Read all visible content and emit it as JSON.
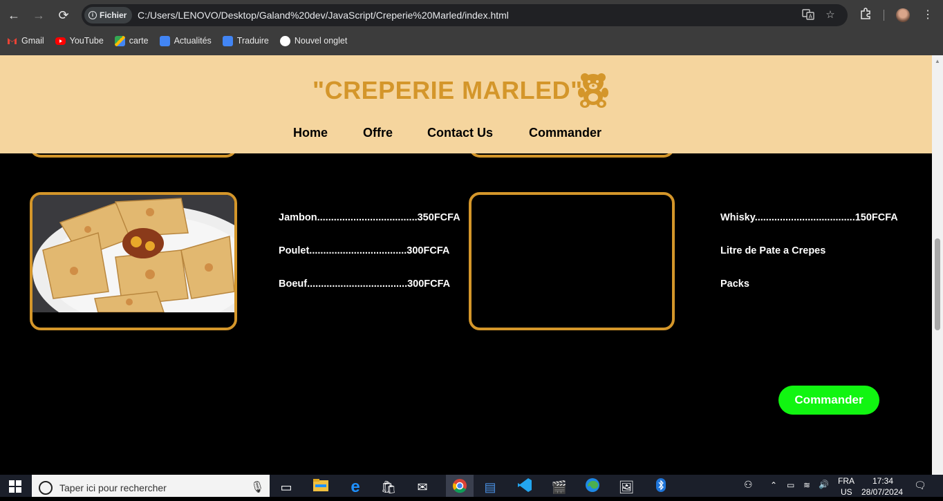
{
  "browser": {
    "back": "←",
    "forward": "→",
    "reload": "⟳",
    "chip_label": "Fichier",
    "url": "C:/Users/LENOVO/Desktop/Galand%20dev/JavaScript/Creperie%20Marled/index.html",
    "bookmarks": [
      {
        "label": "Gmail",
        "icon": "gmail-icon",
        "color": "#ea4335"
      },
      {
        "label": "YouTube",
        "icon": "youtube-icon",
        "color": "#ff0000"
      },
      {
        "label": "carte",
        "icon": "maps-icon",
        "color": "#34a853"
      },
      {
        "label": "Actualités",
        "icon": "news-icon",
        "color": "#4285f4"
      },
      {
        "label": "Traduire",
        "icon": "translate-icon",
        "color": "#4285f4"
      },
      {
        "label": "Nouvel onglet",
        "icon": "globe-icon",
        "color": "#ffffff"
      }
    ]
  },
  "site": {
    "brand": "\"CREPERIE MARLED\"",
    "accent": "#d4962a",
    "header_bg": "#f5d59e",
    "menu": [
      "Home",
      "Offre",
      "Contact Us",
      "Commander"
    ]
  },
  "menu_left": {
    "items": [
      "Jambon....................................350FCFA",
      "Poulet...................................300FCFA",
      "Boeuf....................................300FCFA"
    ]
  },
  "menu_right": {
    "items": [
      "Whisky....................................150FCFA",
      "Litre de Pate a Crepes",
      "Packs"
    ]
  },
  "order_button": "Commander",
  "order_button_color": "#11f511",
  "taskbar": {
    "search_placeholder": "Taper ici pour rechercher",
    "lang_top": "FRA",
    "lang_bottom": "US",
    "time": "17:34",
    "date": "28/07/2024"
  }
}
